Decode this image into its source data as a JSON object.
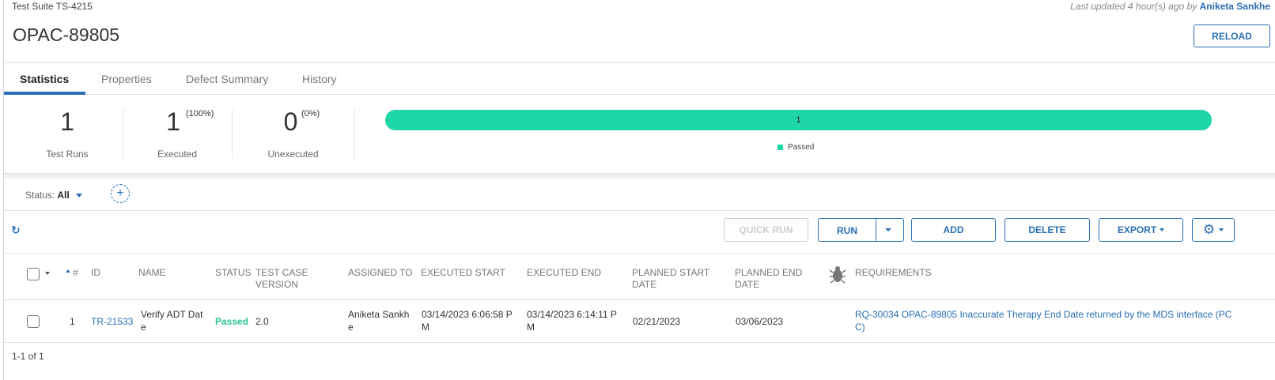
{
  "header": {
    "suite_label": "Test Suite TS-4215",
    "updated_prefix": "Last updated 4 hour(s) ago by ",
    "updated_user": "Aniketa Sankhe",
    "title": "OPAC-89805",
    "reload_label": "RELOAD"
  },
  "tabs": [
    {
      "label": "Statistics"
    },
    {
      "label": "Properties"
    },
    {
      "label": "Defect Summary"
    },
    {
      "label": "History"
    }
  ],
  "stats": {
    "test_runs": {
      "value": "1",
      "label": "Test Runs"
    },
    "executed": {
      "value": "1",
      "pct": "(100%)",
      "label": "Executed"
    },
    "unexecuted": {
      "value": "0",
      "pct": "(0%)",
      "label": "Unexecuted"
    },
    "bar_value": "1",
    "bar_fraction": 1.0,
    "legend_label": "Passed",
    "passed_color": "#1fd6a6"
  },
  "filter": {
    "status_label": "Status:",
    "status_value": "All",
    "add_filter_icon": "plus-icon"
  },
  "toolbar": {
    "refresh_icon": "refresh-icon",
    "quick_run": "QUICK RUN",
    "run": "RUN",
    "add": "ADD",
    "delete": "DELETE",
    "export": "EXPORT",
    "settings_icon": "gear-icon"
  },
  "table": {
    "columns": {
      "num": "#",
      "id": "ID",
      "name": "NAME",
      "status": "STATUS",
      "version_1": "TEST CASE",
      "version_2": "VERSION",
      "assigned": "ASSIGNED TO",
      "exec_start": "EXECUTED START",
      "exec_end": "EXECUTED END",
      "plan_start_1": "PLANNED START",
      "plan_start_2": "DATE",
      "plan_end_1": "PLANNED END",
      "plan_end_2": "DATE",
      "defects_icon": "bug-icon",
      "requirements": "REQUIREMENTS"
    },
    "rows": [
      {
        "num": "1",
        "id": "TR-21533",
        "name_1": "Verify ADT Dat",
        "name_2": "e",
        "status": "Passed",
        "version": "2.0",
        "assigned_1": "Aniketa Sankh",
        "assigned_2": "e",
        "exec_start_1": "03/14/2023 6:06:58 P",
        "exec_start_2": "M",
        "exec_end_1": "03/14/2023 6:14:11 P",
        "exec_end_2": "M",
        "plan_start": "02/21/2023",
        "plan_end": "03/06/2023",
        "req_1": "RQ-30034 OPAC-89805 Inaccurate Therapy End Date returned by the MDS interface (PC",
        "req_2": "C)"
      }
    ]
  },
  "footer": {
    "pagination": "1-1 of 1"
  }
}
